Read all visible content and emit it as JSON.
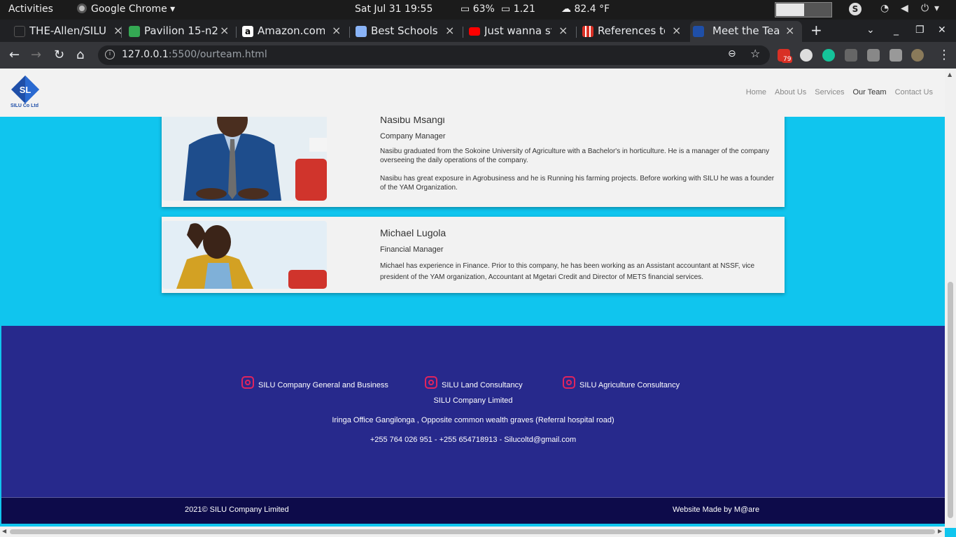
{
  "topbar": {
    "activities": "Activities",
    "app": "Google Chrome",
    "clock": "Sat Jul 31  19:55",
    "battery": "63%",
    "load": "1.21",
    "weather": "82.4 °F"
  },
  "tabs": [
    {
      "label": "THE-Allen/SILU",
      "icon_color": "#202124"
    },
    {
      "label": "Pavilion 15-n2",
      "icon_color": "#34a853"
    },
    {
      "label": "Amazon.com",
      "icon_color": "#ffffff"
    },
    {
      "label": "Best Schools I",
      "icon_color": "#8ab4f8"
    },
    {
      "label": "Just wanna st",
      "icon_color": "#ff0000"
    },
    {
      "label": "References to",
      "icon_color": "#d93025"
    },
    {
      "label": "Meet the Team",
      "icon_color": "#1f4fa8"
    }
  ],
  "toolbar": {
    "url_host": "127.0.0.1",
    "url_path": ":5500/ourteam.html",
    "ext_badge": "79"
  },
  "site": {
    "logo_text": "SILU Co Ltd",
    "logo_letters": "SL",
    "nav": [
      "Home",
      "About Us",
      "Services",
      "Our Team",
      "Contact Us"
    ],
    "active_nav": "Our Team"
  },
  "team": [
    {
      "name": "Nasibu Msangi",
      "role": "Company Manager",
      "bio": [
        "Nasibu graduated from the Sokoine University of Agriculture with a Bachelor's in horticulture. He is a manager of the company overseeing the daily operations of the company.",
        "Nasibu has great exposure in Agrobusiness and he is Running his farming projects. Before working with SILU he was a founder of the YAM Organization."
      ]
    },
    {
      "name": "Michael Lugola",
      "role": "Financial Manager",
      "bio": [
        "Michael has experience in Finance. Prior to this company, he has been working as an Assistant accountant at NSSF, vice president of the YAM organization, Accountant at Mgetari Credit and Director of METS financial services."
      ]
    }
  ],
  "footer": {
    "social": [
      "SILU Company General and Business",
      "SILU Land Consultancy",
      "SILU Agriculture Consultancy"
    ],
    "company": "SILU Company Limited",
    "address": "Iringa Office Gangilonga , Opposite common wealth graves (Referral hospital road)",
    "contacts": "+255 764 026 951 - +255 654718913 - Silucoltd@gmail.com",
    "copyright": "2021© SILU Company Limited",
    "made_by": "Website Made by M@are"
  }
}
